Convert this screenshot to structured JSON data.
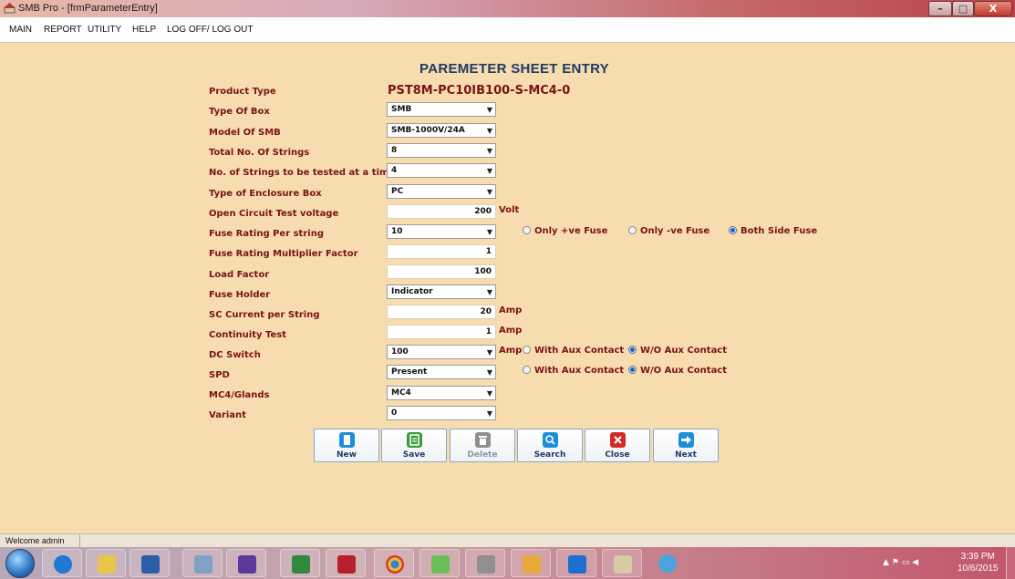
{
  "window": {
    "title": "SMB Pro - [frmParameterEntry]"
  },
  "menu": [
    "MAIN",
    "REPORT",
    "UTILITY",
    "HELP",
    "LOG OFF/ LOG OUT"
  ],
  "form": {
    "heading": "PAREMETER SHEET ENTRY",
    "product_type": {
      "label": "Product Type",
      "value": "PST8M-PC10IB100-S-MC4-0"
    },
    "type_of_box": {
      "label": "Type Of Box",
      "value": "SMB"
    },
    "model_of_smb": {
      "label": "Model Of SMB",
      "value": "SMB-1000V/24A"
    },
    "total_strings": {
      "label": "Total No. Of Strings",
      "value": "8"
    },
    "strings_tested": {
      "label": "No. of Strings to be tested at a time",
      "value": "4"
    },
    "enclosure_box": {
      "label": "Type of Enclosure Box",
      "value": "PC"
    },
    "open_circuit_voltage": {
      "label": "Open Circuit Test voltage",
      "value": "200",
      "unit": "Volt"
    },
    "fuse_rating": {
      "label": "Fuse Rating Per string",
      "value": "10",
      "options": [
        "Only +ve Fuse",
        "Only -ve Fuse",
        "Both Side Fuse"
      ],
      "selected": "Both Side Fuse"
    },
    "fuse_multiplier": {
      "label": "Fuse Rating Multiplier Factor",
      "value": "1"
    },
    "load_factor": {
      "label": "Load Factor",
      "value": "100"
    },
    "fuse_holder": {
      "label": "Fuse Holder",
      "value": "Indicator"
    },
    "sc_current": {
      "label": "SC Current per String",
      "value": "20",
      "unit": "Amp"
    },
    "continuity_test": {
      "label": "Continuity Test",
      "value": "1",
      "unit": "Amp"
    },
    "dc_switch": {
      "label": "DC Switch",
      "value": "100",
      "unit": "Amp",
      "options": [
        "With Aux Contact",
        "W/O Aux Contact"
      ],
      "selected": "W/O Aux Contact"
    },
    "spd": {
      "label": "SPD",
      "value": "Present",
      "options": [
        "With Aux Contact",
        "W/O Aux Contact"
      ],
      "selected": "W/O Aux Contact"
    },
    "mc4_glands": {
      "label": "MC4/Glands",
      "value": "MC4"
    },
    "variant": {
      "label": "Variant",
      "value": "0"
    }
  },
  "buttons": {
    "new": "New",
    "save": "Save",
    "delete": "Delete",
    "search": "Search",
    "close": "Close",
    "next": "Next"
  },
  "status": {
    "text": "Welcome admin"
  },
  "taskbar": {
    "time": "3:39 PM",
    "date": "10/6/2015"
  },
  "colors": {
    "label": "#7a1414",
    "heading": "#1f3b63",
    "background": "#f6dcae",
    "radio_selected": "#1b5fb5"
  }
}
